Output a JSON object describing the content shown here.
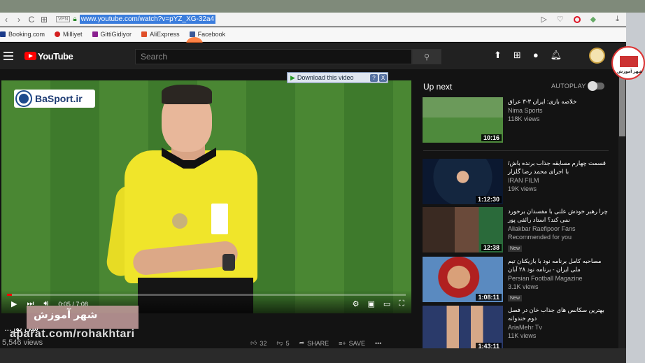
{
  "browser": {
    "nav_back": "‹",
    "nav_forward": "›",
    "nav_reload": "C",
    "apps_icon": "⊞",
    "vpn_label": "VPN",
    "url": "www.youtube.com/watch?v=pYZ_XG-32a4",
    "bookmarks": [
      {
        "label": "Booking.com",
        "color": "#1a3a8a"
      },
      {
        "label": "Milliyet",
        "color": "#d42020"
      },
      {
        "label": "GittiGidiyor",
        "color": "#8a2090"
      },
      {
        "label": "AliExpress",
        "color": "#e0502a"
      },
      {
        "label": "Facebook",
        "color": "#3b5998"
      }
    ]
  },
  "youtube": {
    "logo_text": "YouTube",
    "search_placeholder": "Search",
    "download_bar": "Download this video",
    "download_help": "?",
    "download_close": "X",
    "player": {
      "channel_logo": "BaSport.ir",
      "time_current": "0:05",
      "time_total": "7:08",
      "progress_fraction": 0.012
    },
    "video_title": "‌ ...سی پور",
    "views": "5,546 views",
    "likes": "32",
    "dislikes": "5",
    "share_label": "SHARE",
    "save_label": "SAVE",
    "more_label": "•••",
    "up_next_label": "Up next",
    "autoplay_label": "AUTOPLAY",
    "sidebar": [
      {
        "title": "خلاصه بازی: ایران ۳-۳ عراق",
        "channel": "Nima Sports",
        "views": "118K views",
        "duration": "10:16",
        "badge": "",
        "badge2": ""
      },
      {
        "title": "قسمت چهارم مسابقه جذاب برنده باش/با اجرای محمد رضا گلزار",
        "channel": "IRAN FILM",
        "views": "19K views",
        "duration": "1:12:30",
        "badge": "",
        "badge2": ""
      },
      {
        "title": "چرا رهبر خودش علنی با مفسدان برخورد نمی کند؟ استاد رائفی پور",
        "channel": "Aliakbar Raefipoor Fans",
        "views": "Recommended for you",
        "duration": "12:38",
        "badge": "New",
        "badge2": ""
      },
      {
        "title": "مصاحبه کامل برنامه نود با بازیکنان تیم ملی ایران - برنامه نود ۲۸ آبان",
        "channel": "Persian Football Magazine",
        "views": "3.1K views",
        "duration": "1:08:11",
        "badge": "New",
        "badge2": ""
      },
      {
        "title": "بهترین سکانس های جذاب خان در فصل دوم خندوانه",
        "channel": "AriaMehr Tv",
        "views": "11K views",
        "duration": "1:43:11",
        "badge": "",
        "badge2": ""
      }
    ]
  },
  "watermark": {
    "text": "شهر آموزش",
    "url": "aparat.com/rohakhtari",
    "corner_text": "شهر آموزش"
  }
}
